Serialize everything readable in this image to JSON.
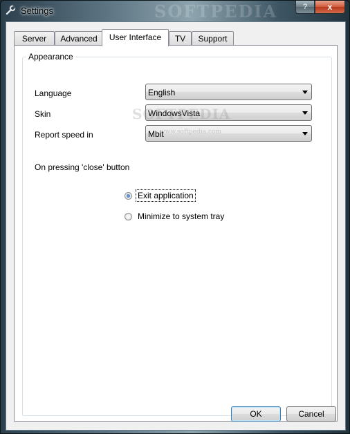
{
  "window": {
    "title": "Settings",
    "watermark": "SOFTPEDIA",
    "help_glyph": "?",
    "close_glyph": "x"
  },
  "tabs": [
    {
      "label": "Server"
    },
    {
      "label": "Advanced"
    },
    {
      "label": "User Interface",
      "active": true
    },
    {
      "label": "TV"
    },
    {
      "label": "Support"
    }
  ],
  "appearance": {
    "group_label": "Appearance",
    "language": {
      "label": "Language",
      "value": "English"
    },
    "skin": {
      "label": "Skin",
      "value": "WindowsVista"
    },
    "report_speed": {
      "label": "Report speed in",
      "value": "Mbit"
    },
    "close_label": "On pressing 'close' button",
    "close_options": [
      {
        "label": "Exit application",
        "checked": true
      },
      {
        "label": "Minimize to system tray",
        "checked": false
      }
    ]
  },
  "buttons": {
    "ok": "OK",
    "cancel": "Cancel"
  },
  "overlay": {
    "watermark_big": "SOFTPEDIA",
    "watermark_small": "www.softpedia.com"
  },
  "colors": {
    "radio_selected": "#1d5aa5",
    "default_button_border": "#3c7fb1"
  },
  "icons": {
    "title": "wrench-icon",
    "combo": "chevron-down-icon"
  }
}
